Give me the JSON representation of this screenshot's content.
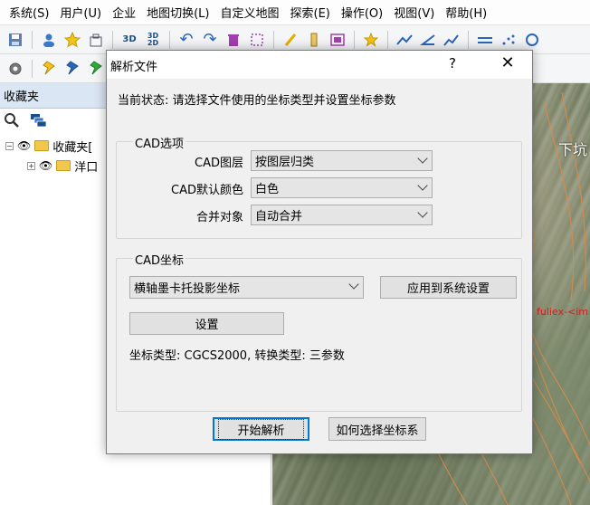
{
  "menubar": {
    "items": [
      "系统(S)",
      "用户(U)",
      "企业",
      "地图切换(L)",
      "自定义地图",
      "探索(E)",
      "操作(O)",
      "视图(V)",
      "帮助(H)"
    ]
  },
  "toolbar": {
    "three_d_label": "3D",
    "three_d2_label": "3D",
    "three_d2_sub": "2D"
  },
  "left_panel": {
    "header": "收藏夹",
    "tree": [
      {
        "label": "收藏夹[",
        "expander": "−"
      },
      {
        "label": "洋口",
        "expander": "+"
      }
    ]
  },
  "map": {
    "label_top": "下坑",
    "label_red": "fuliex-<im"
  },
  "dialog": {
    "title": "解析文件",
    "help_glyph": "?",
    "close_glyph": "✕",
    "status": "当前状态: 请选择文件使用的坐标类型并设置坐标参数",
    "cad_options": {
      "title": "CAD选项",
      "layer_label": "CAD图层",
      "layer_value": "按图层归类",
      "color_label": "CAD默认颜色",
      "color_value": "白色",
      "merge_label": "合并对象",
      "merge_value": "自动合并"
    },
    "cad_coords": {
      "title": "CAD坐标",
      "projection_value": "横轴墨卡托投影坐标",
      "apply_button": "应用到系统设置",
      "settings_button": "设置",
      "info": "坐标类型: CGCS2000, 转换类型: 三参数"
    },
    "start_button": "开始解析",
    "how_button": "如何选择坐标系"
  },
  "colors": {
    "accent": "#0078d7",
    "panel_header": "#dbe6f4",
    "folder": "#f1c84b"
  }
}
